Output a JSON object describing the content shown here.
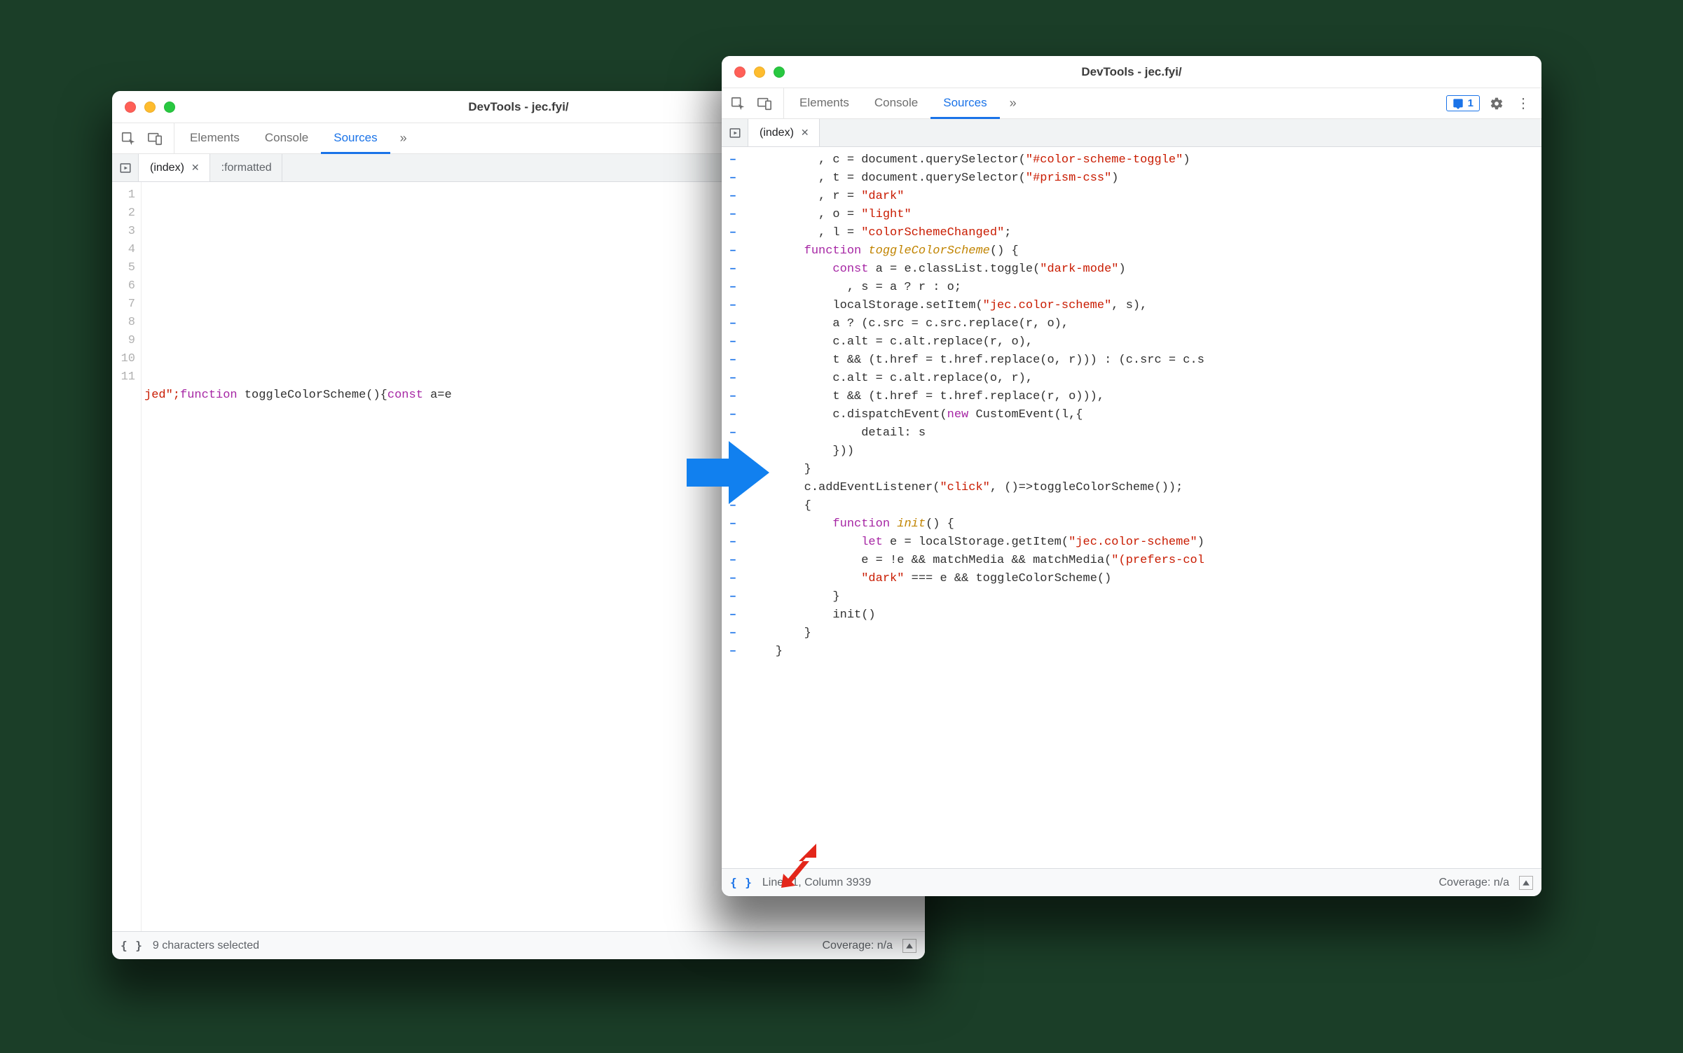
{
  "windowA": {
    "title": "DevTools - jec.fyi/",
    "tabs": {
      "elements": "Elements",
      "console": "Console",
      "sources": "Sources"
    },
    "filetabs": {
      "index": "(index)",
      "formatted": ":formatted"
    },
    "gutter": [
      "1",
      "2",
      "3",
      "4",
      "5",
      "6",
      "7",
      "8",
      "9",
      "10",
      "11"
    ],
    "code_line11": {
      "pre": "jed\";",
      "kw1": "function",
      "fn": " toggleColorScheme(){",
      "kw2": "const",
      "post": " a=e"
    },
    "status": {
      "left": "9 characters selected",
      "coverage": "Coverage: n/a"
    }
  },
  "windowB": {
    "title": "DevTools - jec.fyi/",
    "tabs": {
      "elements": "Elements",
      "console": "Console",
      "sources": "Sources"
    },
    "issues_count": "1",
    "filetabs": {
      "index": "(index)"
    },
    "code": [
      [
        {
          "t": "txt",
          "v": "          , c = document.querySelector("
        },
        {
          "t": "str",
          "v": "\"#color-scheme-toggle\""
        },
        {
          "t": "txt",
          "v": ")"
        }
      ],
      [
        {
          "t": "txt",
          "v": "          , t = document.querySelector("
        },
        {
          "t": "str",
          "v": "\"#prism-css\""
        },
        {
          "t": "txt",
          "v": ")"
        }
      ],
      [
        {
          "t": "txt",
          "v": "          , r = "
        },
        {
          "t": "str",
          "v": "\"dark\""
        }
      ],
      [
        {
          "t": "txt",
          "v": "          , o = "
        },
        {
          "t": "str",
          "v": "\"light\""
        }
      ],
      [
        {
          "t": "txt",
          "v": "          , l = "
        },
        {
          "t": "str",
          "v": "\"colorSchemeChanged\""
        },
        {
          "t": "txt",
          "v": ";"
        }
      ],
      [
        {
          "t": "txt",
          "v": "        "
        },
        {
          "t": "key",
          "v": "function"
        },
        {
          "t": "txt",
          "v": " "
        },
        {
          "t": "fn",
          "v": "toggleColorScheme"
        },
        {
          "t": "txt",
          "v": "() {"
        }
      ],
      [
        {
          "t": "txt",
          "v": "            "
        },
        {
          "t": "key",
          "v": "const"
        },
        {
          "t": "txt",
          "v": " a = e.classList.toggle("
        },
        {
          "t": "str",
          "v": "\"dark-mode\""
        },
        {
          "t": "txt",
          "v": ")"
        }
      ],
      [
        {
          "t": "txt",
          "v": "              , s = a ? r : o;"
        }
      ],
      [
        {
          "t": "txt",
          "v": "            localStorage.setItem("
        },
        {
          "t": "str",
          "v": "\"jec.color-scheme\""
        },
        {
          "t": "txt",
          "v": ", s),"
        }
      ],
      [
        {
          "t": "txt",
          "v": "            a ? (c.src = c.src.replace(r, o),"
        }
      ],
      [
        {
          "t": "txt",
          "v": "            c.alt = c.alt.replace(r, o),"
        }
      ],
      [
        {
          "t": "txt",
          "v": "            t && (t.href = t.href.replace(o, r))) : (c.src = c.s"
        }
      ],
      [
        {
          "t": "txt",
          "v": "            c.alt = c.alt.replace(o, r),"
        }
      ],
      [
        {
          "t": "txt",
          "v": "            t && (t.href = t.href.replace(r, o))),"
        }
      ],
      [
        {
          "t": "txt",
          "v": "            c.dispatchEvent("
        },
        {
          "t": "new",
          "v": "new"
        },
        {
          "t": "txt",
          "v": " CustomEvent(l,{"
        }
      ],
      [
        {
          "t": "txt",
          "v": "                detail: s"
        }
      ],
      [
        {
          "t": "txt",
          "v": "            }))"
        }
      ],
      [
        {
          "t": "txt",
          "v": "        }"
        }
      ],
      [
        {
          "t": "txt",
          "v": "        c.addEventListener("
        },
        {
          "t": "str",
          "v": "\"click\""
        },
        {
          "t": "txt",
          "v": ", ()=>toggleColorScheme());"
        }
      ],
      [
        {
          "t": "txt",
          "v": "        {"
        }
      ],
      [
        {
          "t": "txt",
          "v": "            "
        },
        {
          "t": "key",
          "v": "function"
        },
        {
          "t": "txt",
          "v": " "
        },
        {
          "t": "fn",
          "v": "init"
        },
        {
          "t": "txt",
          "v": "() {"
        }
      ],
      [
        {
          "t": "txt",
          "v": "                "
        },
        {
          "t": "key",
          "v": "let"
        },
        {
          "t": "txt",
          "v": " e = localStorage.getItem("
        },
        {
          "t": "str",
          "v": "\"jec.color-scheme\""
        },
        {
          "t": "txt",
          "v": ")"
        }
      ],
      [
        {
          "t": "txt",
          "v": "                e = !e && matchMedia && matchMedia("
        },
        {
          "t": "str",
          "v": "\"(prefers-col"
        }
      ],
      [
        {
          "t": "txt",
          "v": "                "
        },
        {
          "t": "str",
          "v": "\"dark\""
        },
        {
          "t": "txt",
          "v": " === e && toggleColorScheme()"
        }
      ],
      [
        {
          "t": "txt",
          "v": "            }"
        }
      ],
      [
        {
          "t": "txt",
          "v": "            init()"
        }
      ],
      [
        {
          "t": "txt",
          "v": "        }"
        }
      ],
      [
        {
          "t": "txt",
          "v": "    }"
        }
      ]
    ],
    "status": {
      "pos": "Line 11, Column 3939",
      "coverage": "Coverage: n/a"
    }
  }
}
